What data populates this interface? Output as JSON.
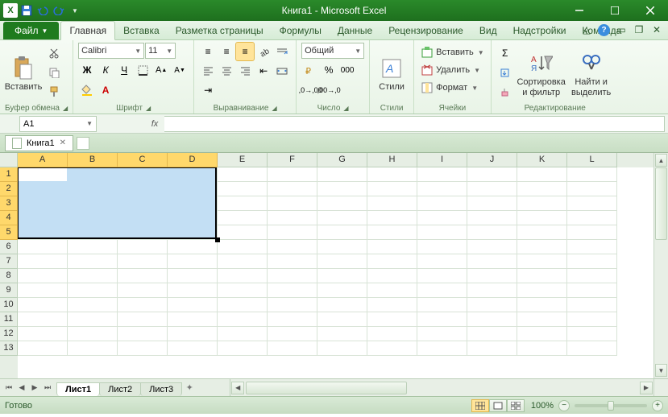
{
  "app": {
    "title": "Книга1 - Microsoft Excel"
  },
  "tabs": {
    "file": "Файл",
    "items": [
      "Главная",
      "Вставка",
      "Разметка страницы",
      "Формулы",
      "Данные",
      "Рецензирование",
      "Вид",
      "Надстройки",
      "Команда"
    ],
    "active": 0
  },
  "ribbon": {
    "clipboard": {
      "label": "Буфер обмена",
      "paste": "Вставить"
    },
    "font": {
      "label": "Шрифт",
      "name": "Calibri",
      "size": "11",
      "bold": "Ж",
      "italic": "К",
      "underline": "Ч"
    },
    "align": {
      "label": "Выравнивание"
    },
    "number": {
      "label": "Число",
      "format": "Общий"
    },
    "styles": {
      "label": "Стили",
      "btn": "Стили"
    },
    "cells": {
      "label": "Ячейки",
      "insert": "Вставить",
      "delete": "Удалить",
      "format": "Формат"
    },
    "editing": {
      "label": "Редактирование",
      "sort": "Сортировка\nи фильтр",
      "find": "Найти и\nвыделить"
    }
  },
  "formulaBar": {
    "nameBox": "A1",
    "fx": "fx",
    "value": ""
  },
  "workbookTab": {
    "name": "Книга1"
  },
  "grid": {
    "cols": [
      "A",
      "B",
      "C",
      "D",
      "E",
      "F",
      "G",
      "H",
      "I",
      "J",
      "K",
      "L"
    ],
    "rows": [
      "1",
      "2",
      "3",
      "4",
      "5",
      "6",
      "7",
      "8",
      "9",
      "10",
      "11",
      "12",
      "13"
    ],
    "selection": {
      "startCol": 0,
      "endCol": 3,
      "startRow": 0,
      "endRow": 4,
      "activeCol": 0,
      "activeRow": 0
    }
  },
  "sheets": {
    "items": [
      "Лист1",
      "Лист2",
      "Лист3"
    ],
    "active": 0
  },
  "status": {
    "ready": "Готово",
    "zoom": "100%"
  }
}
